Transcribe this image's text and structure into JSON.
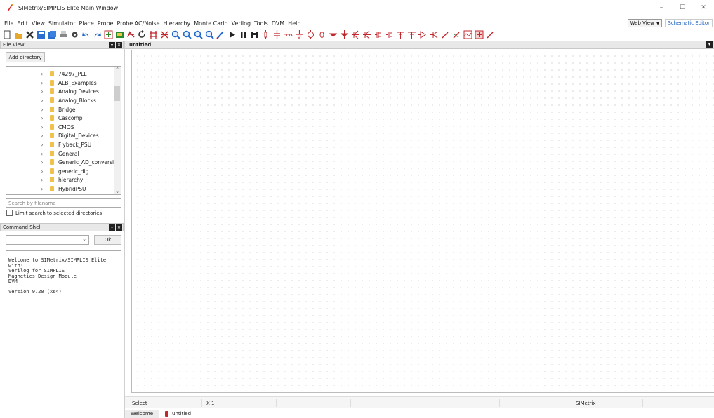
{
  "window": {
    "title": "SIMetrix/SIMPLIS Elite Main Window",
    "controls": {
      "minimize": "–",
      "maximize": "☐",
      "close": "✕"
    }
  },
  "menu": {
    "items": [
      "File",
      "Edit",
      "View",
      "Simulator",
      "Place",
      "Probe",
      "Probe AC/Noise",
      "Hierarchy",
      "Monte Carlo",
      "Verilog",
      "Tools",
      "DVM",
      "Help"
    ],
    "web_view": "Web View",
    "schematic_editor": "Schematic Editor"
  },
  "toolbar": {
    "icons": [
      "new-icon",
      "open-icon",
      "close-icon",
      "save-icon",
      "save-all-icon",
      "print-icon",
      "settings-icon",
      "undo-icon",
      "redo-icon",
      "place-icon",
      "wire-icon",
      "delete-icon",
      "rotate-icon",
      "mirror-icon",
      "bus-icon",
      "zoom-in-icon",
      "zoom-out-icon",
      "zoom-full-icon",
      "zoom-area-icon",
      "probe-icon",
      "run-icon",
      "pause-icon",
      "find-icon",
      "resistor-icon",
      "capacitor-icon",
      "inductor-icon",
      "ground-icon",
      "source-icon",
      "diode-icon",
      "transistor-icon",
      "nmos-icon",
      "pmos-icon",
      "npn-icon",
      "pnp-icon",
      "opamp-icon",
      "comparator-icon",
      "switch-icon",
      "gate-icon",
      "pen-icon",
      "voltage-probe-icon",
      "current-probe-icon",
      "ac-probe-icon",
      "power-probe-icon"
    ],
    "accent": "#c0282d"
  },
  "file_view": {
    "title": "File View",
    "add_directory": "Add directory",
    "folders": [
      "74297_PLL",
      "ALB_Examples",
      "Analog Devices",
      "Analog_Blocks",
      "Bridge",
      "Cascomp",
      "CMOS",
      "Digital_Devices",
      "Flyback_PSU",
      "General",
      "Generic_AD_conversi...",
      "generic_dig",
      "hierarchy",
      "HybridPSU"
    ],
    "search_placeholder": "Search by filename",
    "limit_search": "Limit search to selected directories"
  },
  "command_shell": {
    "title": "Command Shell",
    "ok": "Ok",
    "output": "Welcome to SIMetrix/SIMPLIS Elite\nwith:\nVerilog for SIMPLIS\nMagnetics Design Module\nDVM\n\nVersion 9.20 (x64)"
  },
  "editor": {
    "tab_title": "untitled",
    "status": {
      "mode": "Select",
      "zoom": "X 1",
      "app": "SIMetrix"
    },
    "tabs": [
      "Welcome",
      "untitled"
    ]
  }
}
